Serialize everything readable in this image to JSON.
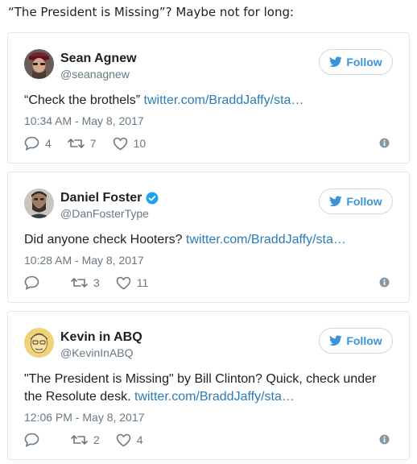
{
  "intro": "“The President is Missing”? Maybe not for long:",
  "colors": {
    "accent": "#3b94d9",
    "link": "#2b7bb9",
    "muted": "#697882"
  },
  "tweets": [
    {
      "name": "Sean Agnew",
      "verified": false,
      "handle": "@seanagnew",
      "text": "“Check the brothels” ",
      "link": "twitter.com/BraddJaffy/sta…",
      "date": "10:34 AM - May 8, 2017",
      "replies": "4",
      "retweets": "7",
      "likes": "10",
      "follow_label": "Follow"
    },
    {
      "name": "Daniel Foster",
      "verified": true,
      "handle": "@DanFosterType",
      "text": "Did anyone check Hooters? ",
      "link": "twitter.com/BraddJaffy/sta…",
      "date": "10:28 AM - May 8, 2017",
      "replies": "",
      "retweets": "3",
      "likes": "11",
      "follow_label": "Follow"
    },
    {
      "name": "Kevin in ABQ",
      "verified": false,
      "handle": "@KevinInABQ",
      "text": "\"The President is Missing\" by Bill Clinton? Quick, check under the Resolute desk. ",
      "link": "twitter.com/BraddJaffy/sta…",
      "date": "12:06 PM - May 8, 2017",
      "replies": "",
      "retweets": "2",
      "likes": "4",
      "follow_label": "Follow"
    }
  ]
}
